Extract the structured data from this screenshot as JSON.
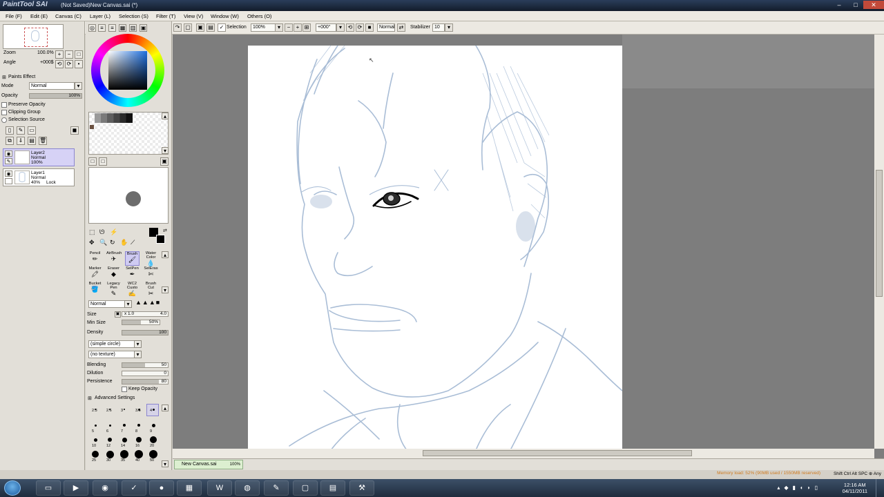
{
  "window": {
    "logo": "PaintTool SAI",
    "title": "(Not Saved)New Canvas.sai (*)",
    "controls": [
      "–",
      "□",
      "✕"
    ]
  },
  "menu": [
    "File (F)",
    "Edit (E)",
    "Canvas (C)",
    "Layer (L)",
    "Selection (S)",
    "Filter (T)",
    "View (V)",
    "Window (W)",
    "Others (O)"
  ],
  "toolbar": {
    "selection_label": "Selection",
    "zoom": "100%",
    "rotation": "+000°",
    "mode": "Normal",
    "stabilizer_label": "Stabilizer",
    "stabilizer_value": "10"
  },
  "navigator": {
    "zoom_label": "Zoom",
    "zoom_value": "100.0%",
    "angle_label": "Angle",
    "angle_value": "+000$"
  },
  "layer_props": {
    "paints_effect": "Paints Effect",
    "mode_label": "Mode",
    "mode_value": "Normal",
    "opacity_label": "Opacity",
    "opacity_value": "100%",
    "preserve_opacity": "Preserve Opacity",
    "clipping_group": "Clipping Group",
    "selection_source": "Selection Source"
  },
  "layers": [
    {
      "name": "Layer2",
      "mode": "Normal",
      "opacity": "100%",
      "lock": "",
      "selected": true
    },
    {
      "name": "Layer1",
      "mode": "Normal",
      "opacity": "40%",
      "lock": "Lock",
      "selected": false
    }
  ],
  "tools": [
    {
      "label": "Pencil",
      "selected": false
    },
    {
      "label": "AirBrush",
      "selected": false
    },
    {
      "label": "Brush",
      "selected": true
    },
    {
      "label": "Water Color",
      "selected": false
    },
    {
      "label": "Marker",
      "selected": false
    },
    {
      "label": "Eraser",
      "selected": false
    },
    {
      "label": "SelPen",
      "selected": false
    },
    {
      "label": "SelEras",
      "selected": false
    },
    {
      "label": "Bucket",
      "selected": false
    },
    {
      "label": "Legacy Pen",
      "selected": false
    },
    {
      "label": "WC2 Custo",
      "selected": false
    },
    {
      "label": "Brush Cut",
      "selected": false
    }
  ],
  "brush": {
    "blend_mode": "Normal",
    "size_label": "Size",
    "size_mult": "x 1.0",
    "size_value": "4.0",
    "minsize_label": "Min Size",
    "minsize_value": "50%",
    "minsize_fraction": 0.5,
    "density_label": "Density",
    "density_value": "100",
    "density_fraction": 1.0,
    "shape": "(simple circle)",
    "texture": "(no texture)",
    "blending_label": "Blending",
    "blending_value": "50",
    "blending_fraction": 0.5,
    "dilution_label": "Dilution",
    "dilution_value": "0",
    "dilution_fraction": 0.0,
    "persistence_label": "Persistence",
    "persistence_value": "80",
    "persistence_fraction": 0.8,
    "keep_opacity": "Keep Opacity",
    "advanced_settings": "Advanced Settings"
  },
  "brush_sizes": [
    [
      "2.3",
      "2.6",
      "3",
      "3.5",
      "4"
    ],
    [
      "5",
      "6",
      "7",
      "8",
      "9"
    ],
    [
      "10",
      "12",
      "14",
      "16",
      "20"
    ],
    [
      "25",
      "30",
      "35",
      "40",
      "50"
    ]
  ],
  "document": {
    "tab_name": "New Canvas.sai",
    "tab_zoom": "100%"
  },
  "status": {
    "memory": "Memory load: 52% (90MB used / 1550MB reserved)",
    "keys": "Shift Ctrl Alt SPC ⊕ Any"
  },
  "clock": {
    "time": "12:16 AM",
    "date": "04/11/2011"
  },
  "colors": {
    "accent_selected": "#d6d2f6",
    "canvas_bg": "#7d7d7d",
    "sketch_line": "#a9bdd6"
  }
}
